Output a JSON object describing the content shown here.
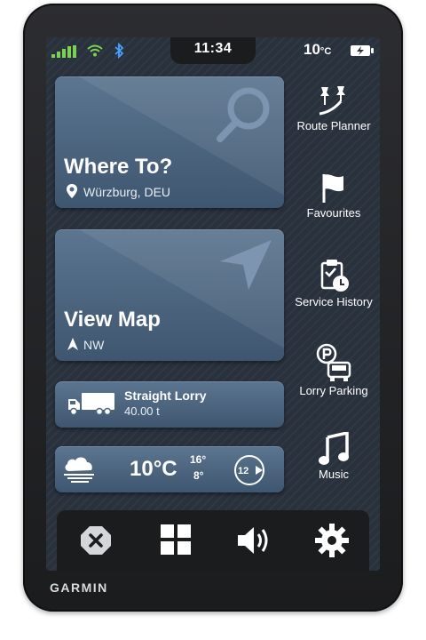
{
  "status": {
    "time": "11:34",
    "temperature": "10",
    "temperature_unit": "°C",
    "icons": [
      "signal-icon",
      "wifi-icon",
      "bluetooth-icon",
      "battery-charging-icon"
    ]
  },
  "tiles": {
    "where_to": {
      "title": "Where To?",
      "location": "Würzburg, DEU"
    },
    "view_map": {
      "title": "View Map",
      "heading": "NW"
    },
    "vehicle": {
      "name": "Straight Lorry",
      "weight": "40.00 t"
    },
    "weather": {
      "temperature": "10°C",
      "high": "16°",
      "low": "8°",
      "wind_speed": "12"
    }
  },
  "sidebar": {
    "items": [
      {
        "label": "Route Planner",
        "icon": "route-planner-icon"
      },
      {
        "label": "Favourites",
        "icon": "flag-icon"
      },
      {
        "label": "Service History",
        "icon": "service-history-icon"
      },
      {
        "label": "Lorry Parking",
        "icon": "lorry-parking-icon"
      },
      {
        "label": "Music",
        "icon": "music-note-icon"
      }
    ]
  },
  "bottombar": {
    "icons": [
      "close-icon",
      "apps-grid-icon",
      "volume-icon",
      "gear-icon"
    ]
  },
  "device": {
    "brand": "GARMIN"
  },
  "colors": {
    "tile": "#4d6681",
    "screen_bg": "#29313d",
    "accent_green": "#7bd24f",
    "bluetooth": "#4aa3ff"
  }
}
